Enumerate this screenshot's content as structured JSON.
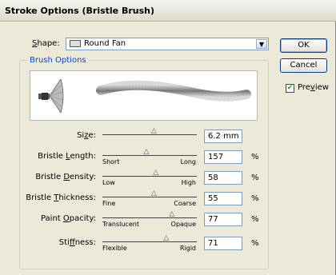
{
  "window": {
    "title": "Stroke Options (Bristle Brush)"
  },
  "shape": {
    "label_pre": "",
    "label_u": "S",
    "label_post": "hape:",
    "value": "Round Fan"
  },
  "buttons": {
    "ok": "OK",
    "cancel": "Cancel"
  },
  "preview_toggle": {
    "label_pre": "Pre",
    "label_u": "v",
    "label_post": "iew",
    "checked": true
  },
  "brush_options": {
    "title": "Brush Options"
  },
  "params": [
    {
      "label_pre": "Si",
      "label_u": "z",
      "label_post": "e:",
      "min": "",
      "max": "",
      "value": "6.2 mm",
      "unit": "",
      "level": 0.55
    },
    {
      "label_pre": "Bristle ",
      "label_u": "L",
      "label_post": "ength:",
      "min": "Short",
      "max": "Long",
      "value": "157",
      "unit": "%",
      "level": 0.47
    },
    {
      "label_pre": "Bristle ",
      "label_u": "D",
      "label_post": "ensity:",
      "min": "Low",
      "max": "High",
      "value": "58",
      "unit": "%",
      "level": 0.57
    },
    {
      "label_pre": "Bristle ",
      "label_u": "T",
      "label_post": "hickness:",
      "min": "Fine",
      "max": "Coarse",
      "value": "55",
      "unit": "%",
      "level": 0.55
    },
    {
      "label_pre": "Paint ",
      "label_u": "O",
      "label_post": "pacity:",
      "min": "Translucent",
      "max": "Opaque",
      "value": "77",
      "unit": "%",
      "level": 0.74
    },
    {
      "label_pre": "Sti",
      "label_u": "f",
      "label_post": "fness:",
      "min": "Flexible",
      "max": "Rigid",
      "value": "71",
      "unit": "%",
      "level": 0.68
    }
  ],
  "colors": {
    "focus_border": "#7f9db9",
    "group_title": "#0046d5"
  }
}
